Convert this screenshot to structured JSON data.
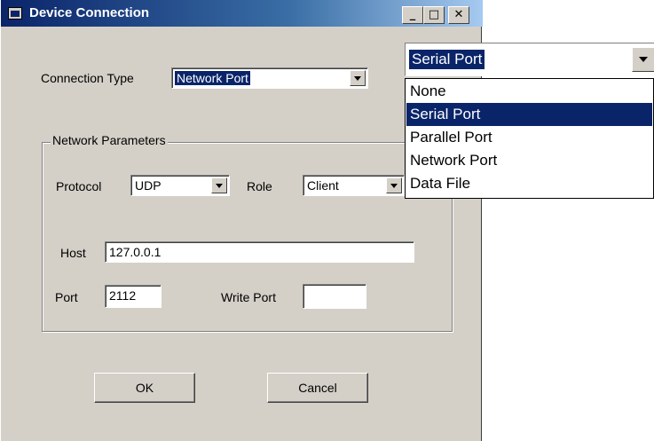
{
  "window": {
    "title": "Device Connection",
    "buttons": {
      "minimize": "_",
      "maximize": "□",
      "close": "✕"
    }
  },
  "connection": {
    "label": "Connection Type",
    "value": "Network Port"
  },
  "network": {
    "group_title": "Network Parameters",
    "protocol_label": "Protocol",
    "protocol_value": "UDP",
    "role_label": "Role",
    "role_value": "Client",
    "host_label": "Host",
    "host_value": "127.0.0.1",
    "port_label": "Port",
    "port_value": "2112",
    "write_port_label": "Write Port",
    "write_port_value": ""
  },
  "actions": {
    "ok": "OK",
    "cancel": "Cancel"
  },
  "dropdown": {
    "selected": "Serial Port",
    "options": [
      "None",
      "Serial Port",
      "Parallel Port",
      "Network Port",
      "Data File"
    ],
    "highlighted_index": 1
  },
  "colors": {
    "face": "#d4d0c8",
    "title_start": "#0a246a",
    "title_end": "#a6caf0",
    "highlight": "#0a246a"
  }
}
